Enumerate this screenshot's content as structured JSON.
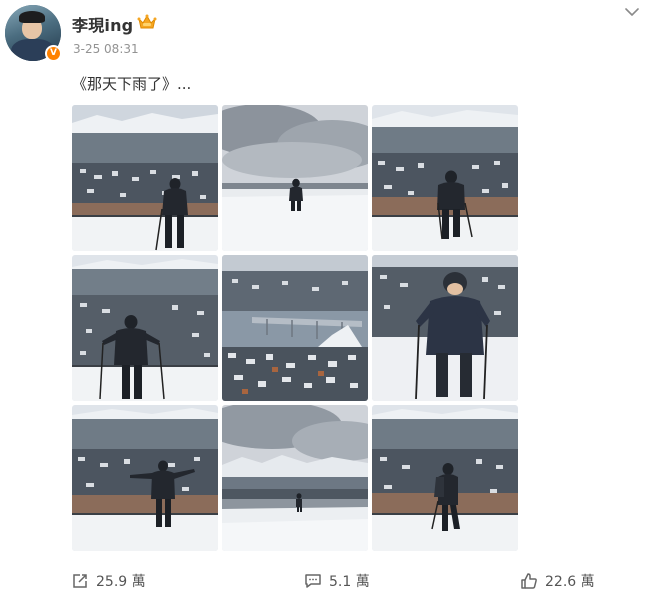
{
  "post": {
    "author": {
      "name": "李現ing",
      "verified": true,
      "avatar_icon": "avatar",
      "badge_icon": "crown-icon",
      "verified_mark": "V"
    },
    "timestamp": "3-25 08:31",
    "text": "《那天下雨了》...",
    "photos": [
      {
        "label": "snowy-lookout-hiker-back"
      },
      {
        "label": "snow-field-overcast-sky"
      },
      {
        "label": "hiker-walking-poles"
      },
      {
        "label": "hiker-arms-out-poles"
      },
      {
        "label": "bridge-city-view"
      },
      {
        "label": "hiker-closeup-smile"
      },
      {
        "label": "hiker-arms-spread"
      },
      {
        "label": "distant-hiker-snow-field"
      },
      {
        "label": "hiker-side-walking"
      }
    ],
    "actions": {
      "repost": {
        "icon": "repost-icon",
        "count": "25.9 萬"
      },
      "comment": {
        "icon": "comment-icon",
        "count": "5.1 萬"
      },
      "like": {
        "icon": "like-icon",
        "count": "22.6 萬"
      }
    },
    "colors": {
      "verified_badge": "#ff8200",
      "crown": "#f5a623",
      "secondary_text": "#939393"
    }
  }
}
